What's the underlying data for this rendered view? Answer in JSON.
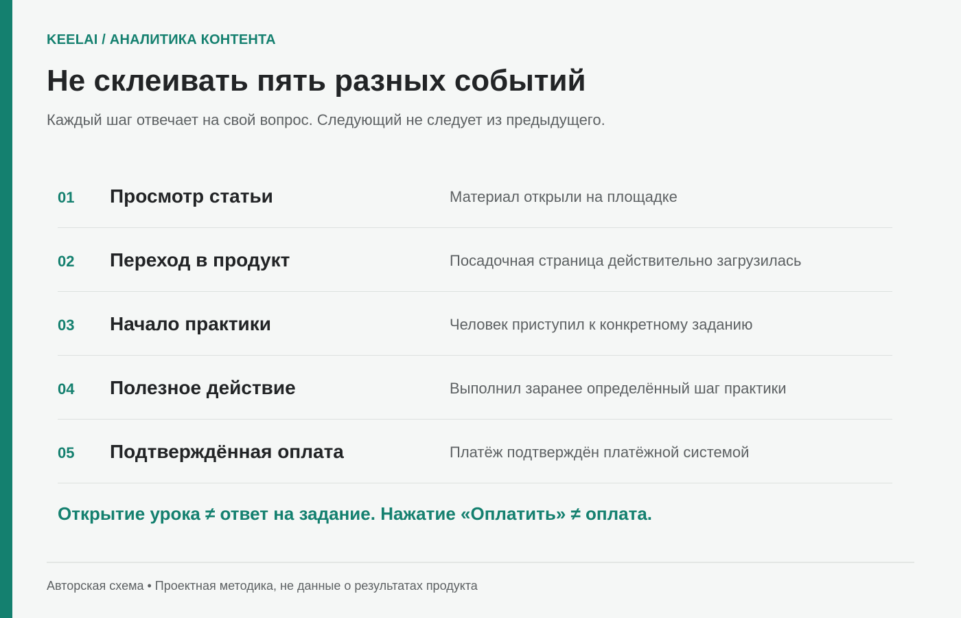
{
  "colors": {
    "accent": "#14806f",
    "background": "#f5f7f6",
    "title": "#222426",
    "muted": "#5d6163",
    "divider": "#dde1df"
  },
  "header": {
    "eyebrow": "KEELAI / АНАЛИТИКА КОНТЕНТА",
    "title": "Не склеивать пять разных событий",
    "subtitle": "Каждый шаг отвечает на свой вопрос. Следующий не следует из предыдущего."
  },
  "steps": [
    {
      "num": "01",
      "name": "Просмотр статьи",
      "desc": "Материал открыли на площадке"
    },
    {
      "num": "02",
      "name": "Переход в продукт",
      "desc": "Посадочная страница действительно загрузилась"
    },
    {
      "num": "03",
      "name": "Начало практики",
      "desc": "Человек приступил к конкретному заданию"
    },
    {
      "num": "04",
      "name": "Полезное действие",
      "desc": "Выполнил заранее определённый шаг практики"
    },
    {
      "num": "05",
      "name": "Подтверждённая оплата",
      "desc": "Платёж подтверждён платёжной системой"
    }
  ],
  "callout": "Открытие урока ≠ ответ на задание. Нажатие «Оплатить» ≠ оплата.",
  "footer": {
    "note": "Авторская схема • Проектная методика, не данные о результатах продукта"
  }
}
